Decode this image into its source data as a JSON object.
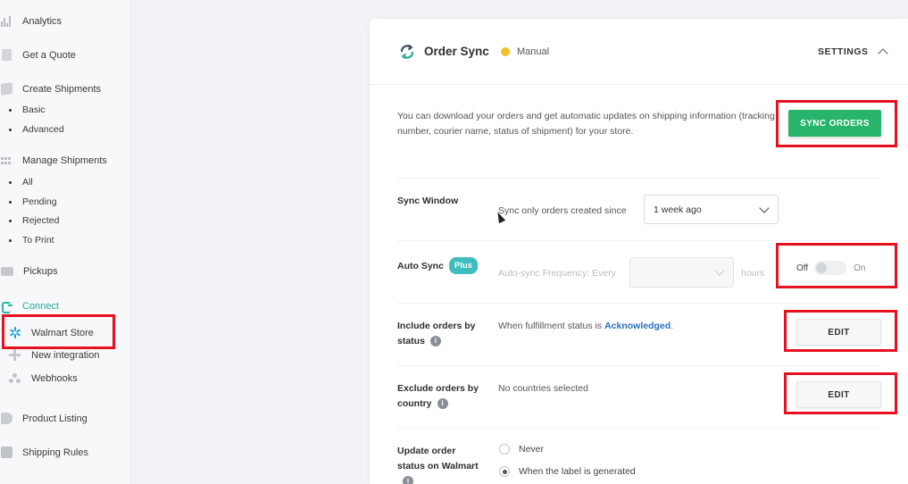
{
  "sidebar": {
    "items": [
      {
        "label": "Analytics",
        "icon": "bar-chart-icon"
      },
      {
        "label": "Get a Quote",
        "icon": "document-icon"
      },
      {
        "label": "Create Shipments",
        "icon": "box-icon"
      },
      {
        "label": "Manage Shipments",
        "icon": "grid-icon"
      },
      {
        "label": "Pickups",
        "icon": "truck-icon"
      },
      {
        "label": "Connect",
        "icon": "plug-icon"
      },
      {
        "label": "Product Listing",
        "icon": "tag-icon"
      },
      {
        "label": "Shipping Rules",
        "icon": "rules-icon"
      }
    ],
    "create_sub": [
      "Basic",
      "Advanced"
    ],
    "manage_sub": [
      "All",
      "Pending",
      "Rejected",
      "To Print"
    ],
    "connect_sub": [
      {
        "label": "Walmart Store",
        "icon": "walmart-spark-icon"
      },
      {
        "label": "New integration",
        "icon": "plus-icon"
      },
      {
        "label": "Webhooks",
        "icon": "webhooks-icon"
      }
    ]
  },
  "card": {
    "title": "Order Sync",
    "status": "Manual",
    "status_color": "#f5c02a",
    "settings_label": "SETTINGS",
    "description": "You can download your orders and get automatic updates on shipping information (tracking number, courier name, status of shipment) for your store.",
    "sync_orders_label": "SYNC ORDERS",
    "sync_window": {
      "label": "Sync Window",
      "text": "Sync only orders created since",
      "value": "1 week ago"
    },
    "auto_sync": {
      "label": "Auto Sync",
      "badge": "Plus",
      "freq_text": "Auto-sync Frequency: Every",
      "unit": "hours",
      "off": "Off",
      "on": "On"
    },
    "include": {
      "label_line1": "Include orders by",
      "label_line2": "status",
      "text_prefix": "When fulfillment status is",
      "status": "Acknowledged",
      "suffix": ".",
      "edit": "EDIT"
    },
    "exclude": {
      "label_line1": "Exclude orders by",
      "label_line2": "country",
      "text": "No countries selected",
      "edit": "EDIT"
    },
    "update": {
      "label_line1": "Update order",
      "label_line2": "status on Walmart",
      "opt_never": "Never",
      "opt_label": "When the label is generated"
    }
  },
  "colors": {
    "accent_green": "#28b46a",
    "teal": "#2aa897",
    "highlight_red": "#e8101f",
    "link_blue": "#2a6fb8"
  }
}
